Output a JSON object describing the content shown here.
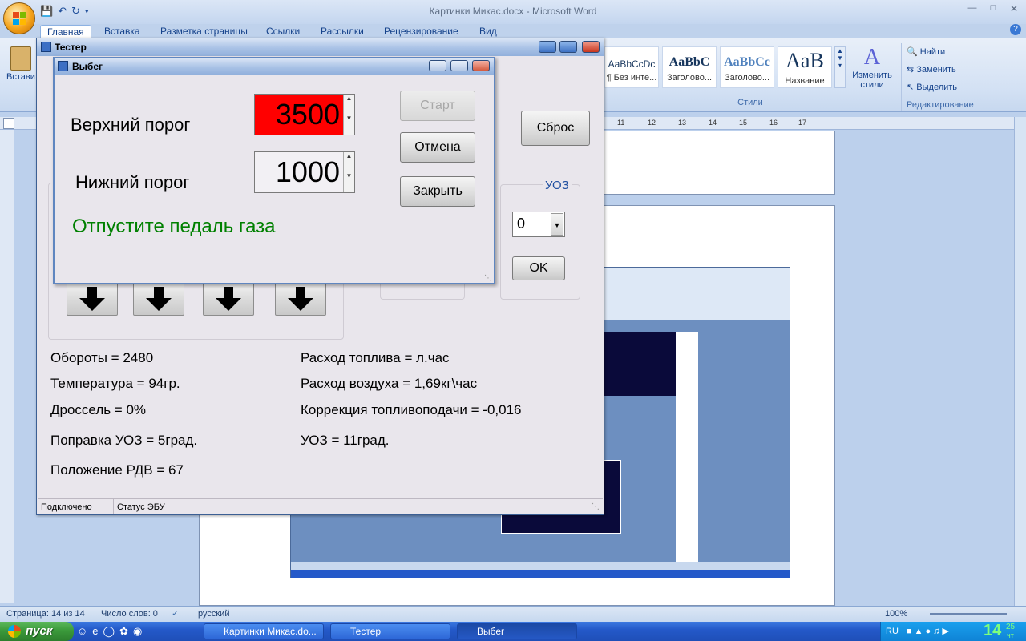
{
  "word": {
    "title": "Картинки Микас.docx - Microsoft Word",
    "tabs": [
      "Главная",
      "Вставка",
      "Разметка страницы",
      "Ссылки",
      "Рассылки",
      "Рецензирование",
      "Вид"
    ],
    "paste_label": "Вставить",
    "styles": [
      {
        "sample": "AaBbCcDc",
        "name": "¶ Без инте..."
      },
      {
        "sample": "AaBbC",
        "name": "Заголово..."
      },
      {
        "sample": "AaBbCc",
        "name": "Заголово..."
      },
      {
        "sample": "AaB",
        "name": "Название"
      }
    ],
    "change_styles": "Изменить стили",
    "styles_group": "Стили",
    "edit": {
      "find": "Найти",
      "replace": "Заменить",
      "select": "Выделить",
      "group": "Редактирование"
    },
    "ruler_marks": [
      "11",
      "12",
      "13",
      "14",
      "15",
      "16",
      "17"
    ],
    "status": {
      "page": "Страница: 14 из 14",
      "words": "Число слов: 0",
      "lang": "русский",
      "zoom": "100%"
    }
  },
  "taskbar": {
    "start": "пуск",
    "tasks": [
      "Картинки Микас.do...",
      "Тестер",
      "Выбег"
    ],
    "lang": "RU",
    "clock": "14",
    "clock_min": "25",
    "clock_day": "чт"
  },
  "tester": {
    "title": "Тестер",
    "reset_label": "Сброс",
    "uoz_group": "УОЗ",
    "uoz_value": "0",
    "ok_label": "OK",
    "readings_left": [
      "Обороты = 2480",
      "Температура = 94гр.",
      "Дроссель = 0%",
      "Поправка УОЗ = 5град.",
      "Положение РДВ = 67"
    ],
    "readings_right": [
      "Расход топлива = л.час",
      "Расход воздуха = 1,69кг\\час",
      "Коррекция топливоподачи = -0,016",
      "УОЗ = 11град."
    ],
    "status_connected": "Подключено",
    "status_ecu": "Статус ЭБУ"
  },
  "vybeg": {
    "title": "Выбег",
    "upper_label": "Верхний порог",
    "upper_value": "3500",
    "lower_label": "Нижний порог",
    "lower_value": "1000",
    "start_label": "Старт",
    "cancel_label": "Отмена",
    "close_label": "Закрыть",
    "message": "Отпустите педаль газа",
    "colors": {
      "upper_bg": "#ff0000",
      "message": "#008000"
    }
  }
}
